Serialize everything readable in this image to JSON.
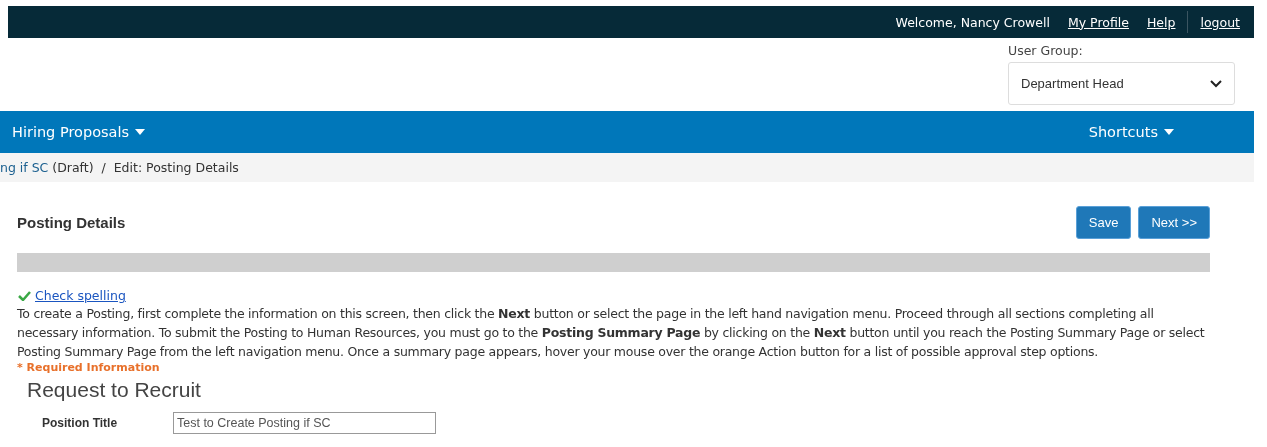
{
  "top_bar": {
    "welcome": "Welcome, Nancy Crowell",
    "links": [
      "My Profile",
      "Help",
      "logout"
    ]
  },
  "user_group": {
    "label": "User Group:",
    "value": "Department Head"
  },
  "nav": {
    "menus": [
      {
        "label": "Hiring Proposals"
      },
      {
        "label": "Shortcuts"
      }
    ]
  },
  "breadcrumb": {
    "link": "ng if SC",
    "rest": "(Draft)  /  Edit: Posting Details"
  },
  "page": {
    "title": "Posting Details",
    "buttons": [
      "Save",
      "Next >>"
    ]
  },
  "spellcheck": "Check spelling",
  "instructions": "To create a Posting, first complete the information on this screen, then click the **Next** button or select the page in the left hand navigation menu. Proceed through all sections completing all necessary information. To submit the Posting to Human Resources, you must go to the **Posting Summary Page** by clicking on the **Next** button until you reach the Posting Summary Page or select Posting Summary Page from the left navigation menu. Once a summary page appears, hover your mouse over the orange Action button for a list of possible approval step options.",
  "required_note": "* Required Information",
  "section": {
    "title": "Request to Recruit",
    "fields": [
      {
        "label": "Position Title",
        "value": "Test to Create Posting if SC"
      }
    ]
  }
}
